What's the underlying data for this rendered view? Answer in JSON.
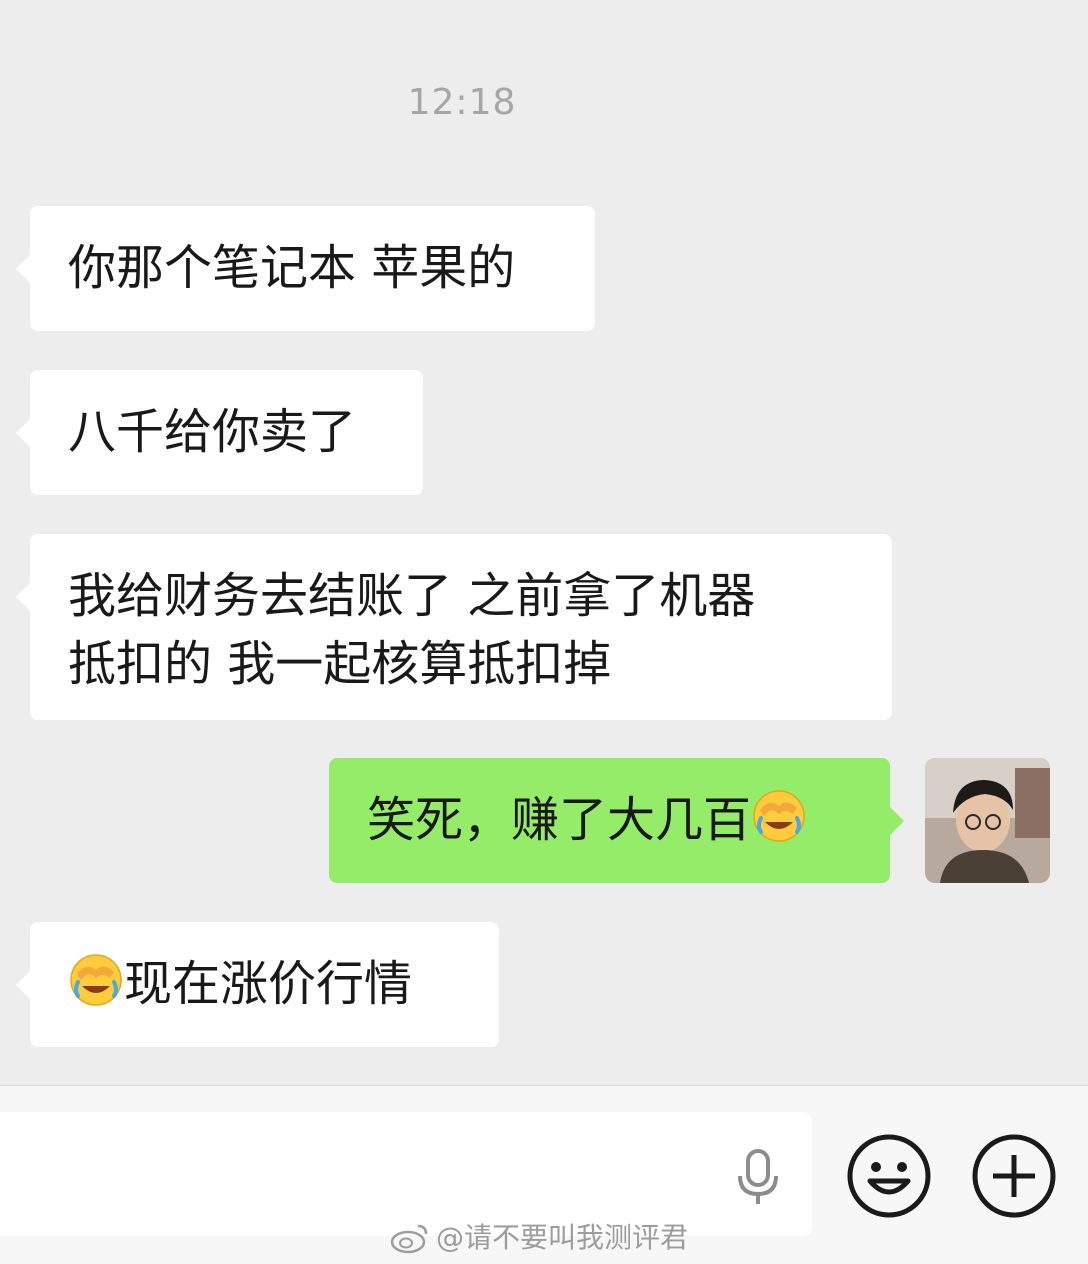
{
  "chat": {
    "timestamp": "12:18",
    "messages": [
      {
        "side": "in",
        "lines": [
          "你那个笔记本 苹果的"
        ]
      },
      {
        "side": "in",
        "lines": [
          "八千给你卖了"
        ]
      },
      {
        "side": "in",
        "lines": [
          "我给财务去结账了 之前拿了机器",
          "抵扣的 我一起核算抵扣掉"
        ]
      },
      {
        "side": "out",
        "text": "笑死，赚了大几百",
        "trailing_emoji": "facepalm-laugh-emoji"
      },
      {
        "side": "in",
        "leading_emoji": "facepalm-laugh-emoji",
        "text": "现在涨价行情"
      }
    ]
  },
  "input_bar": {
    "placeholder": "",
    "icons": [
      "microphone-icon",
      "smiley-icon",
      "plus-icon"
    ]
  },
  "watermark": {
    "text": "@请不要叫我测评君"
  },
  "colors": {
    "background": "#ededed",
    "incoming_bubble": "#ffffff",
    "outgoing_bubble": "#95ec69",
    "text": "#191919",
    "timestamp": "#a6a6a6"
  }
}
